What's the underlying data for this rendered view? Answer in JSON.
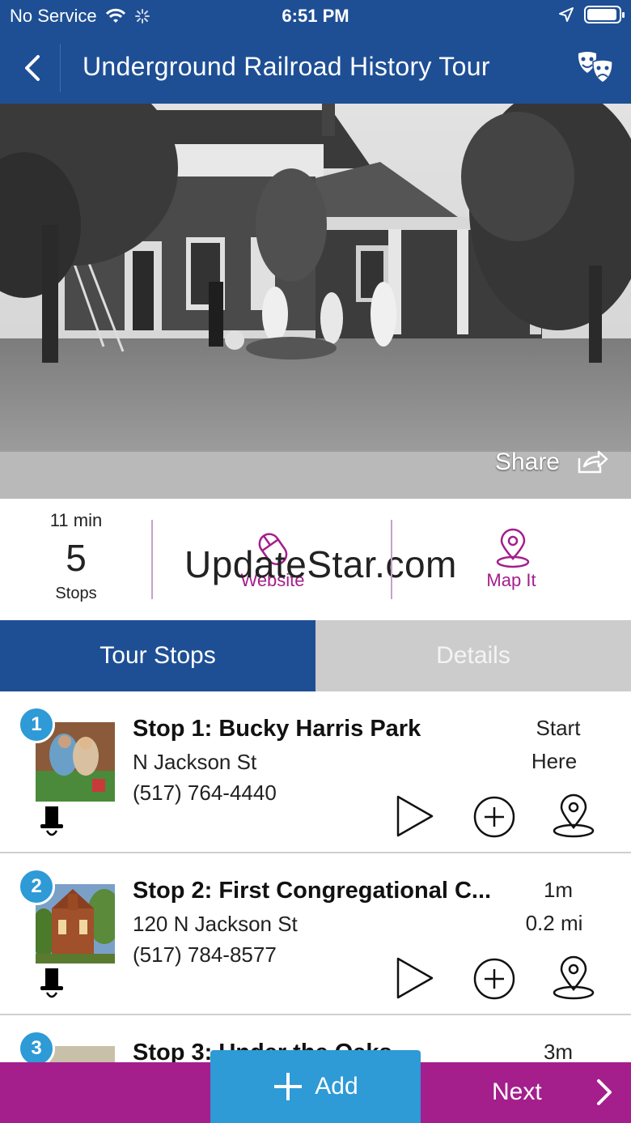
{
  "status_bar": {
    "carrier": "No Service",
    "time": "6:51 PM",
    "battery_level": 0.95
  },
  "nav": {
    "title": "Underground Railroad History Tour",
    "back_icon": "chevron-left-icon",
    "right_icon": "theater-masks-icon"
  },
  "hero": {
    "share_label": "Share"
  },
  "info": {
    "duration": "11 min",
    "stops_count": "5",
    "stops_label": "Stops",
    "website_label": "Website",
    "map_label": "Map It",
    "watermark": "UpdateStar.com"
  },
  "tabs": {
    "tour_stops": "Tour Stops",
    "details": "Details",
    "active": "tour_stops"
  },
  "stops": [
    {
      "number": "1",
      "name": "Stop 1: Bucky Harris Park",
      "address": "N Jackson St",
      "phone": "(517) 764-4440",
      "meta1": "Start",
      "meta2": "Here"
    },
    {
      "number": "2",
      "name": "Stop 2: First Congregational C...",
      "address": "120 N Jackson St",
      "phone": "(517) 784-8577",
      "meta1": "1m",
      "meta2": "0.2 mi"
    },
    {
      "number": "3",
      "name": "Stop 3: Under the Oaks",
      "address": "",
      "phone": "",
      "meta1": "3m",
      "meta2": ""
    }
  ],
  "bottom": {
    "add_label": "Add",
    "next_label": "Next"
  },
  "colors": {
    "primary_blue": "#1e4f95",
    "accent_magenta": "#a41e8c",
    "badge_blue": "#2e9ad6",
    "tab_inactive": "#cccccc"
  }
}
